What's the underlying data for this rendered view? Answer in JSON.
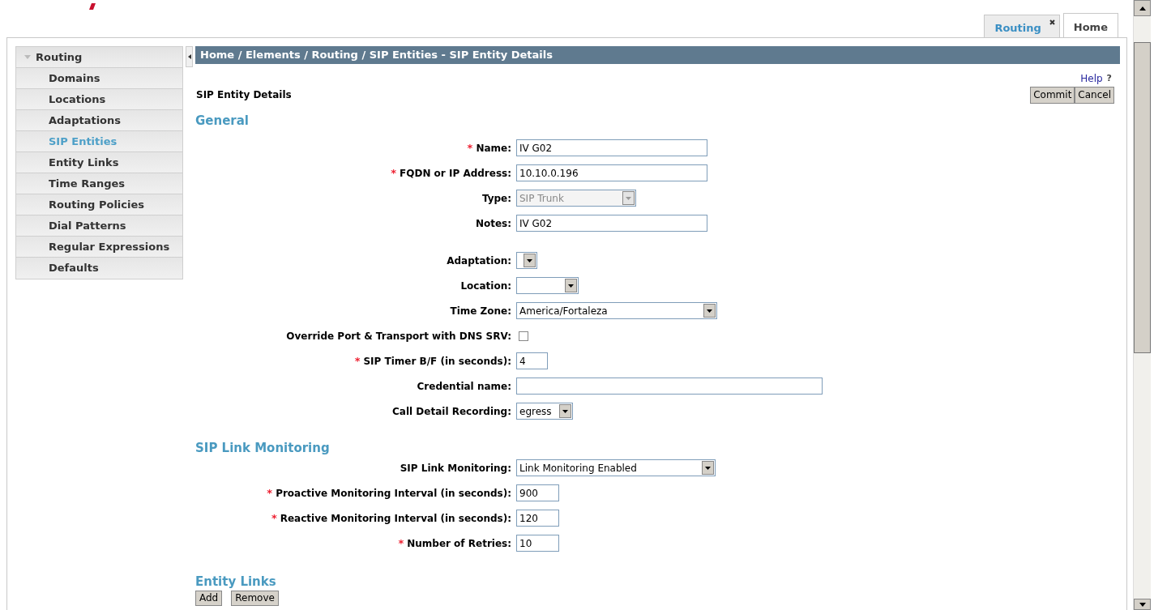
{
  "tabs": [
    {
      "label": "Routing",
      "selected": false,
      "closable": true
    },
    {
      "label": "Home",
      "selected": true,
      "closable": false
    }
  ],
  "sidebar": {
    "header": {
      "label": "Routing",
      "expanded": true
    },
    "items": [
      {
        "label": "Domains",
        "selected": false
      },
      {
        "label": "Locations",
        "selected": false
      },
      {
        "label": "Adaptations",
        "selected": false
      },
      {
        "label": "SIP Entities",
        "selected": true
      },
      {
        "label": "Entity Links",
        "selected": false
      },
      {
        "label": "Time Ranges",
        "selected": false
      },
      {
        "label": "Routing Policies",
        "selected": false
      },
      {
        "label": "Dial Patterns",
        "selected": false
      },
      {
        "label": "Regular Expressions",
        "selected": false
      },
      {
        "label": "Defaults",
        "selected": false
      }
    ]
  },
  "breadcrumb": "Home / Elements / Routing / SIP Entities - SIP Entity Details",
  "help": {
    "label": "Help",
    "mark": "?"
  },
  "page_title": "SIP Entity Details",
  "buttons": [
    "Commit",
    "Cancel"
  ],
  "sections": [
    {
      "title": "General",
      "fields": [
        {
          "label": "Name:",
          "required_mark": "*",
          "kind": "text",
          "value": "IV G02",
          "disabled": false
        },
        {
          "label": "FQDN or IP Address:",
          "required_mark": "*",
          "kind": "text",
          "value": "10.10.0.196",
          "disabled": false
        },
        {
          "label": "Type:",
          "kind": "select",
          "value": "SIP Trunk",
          "disabled": true
        },
        {
          "label": "Notes:",
          "kind": "text",
          "value": "IV G02",
          "disabled": false
        },
        {
          "label": "Adaptation:",
          "kind": "select",
          "disabled": false
        },
        {
          "label": "Location:",
          "kind": "select",
          "disabled": false
        },
        {
          "label": "Time Zone:",
          "kind": "select",
          "value": "America/Fortaleza",
          "disabled": false
        },
        {
          "label": "Override Port & Transport with DNS SRV:",
          "kind": "checkbox",
          "checked": false,
          "disabled": false
        },
        {
          "label": "SIP Timer B/F (in seconds):",
          "required_mark": "*",
          "kind": "text",
          "value": "4",
          "disabled": false
        },
        {
          "label": "Credential name:",
          "kind": "text",
          "disabled": false
        },
        {
          "label": "Call Detail Recording:",
          "kind": "select",
          "value": "egress",
          "disabled": false
        }
      ]
    },
    {
      "title": "SIP Link Monitoring",
      "fields": [
        {
          "label": "SIP Link Monitoring:",
          "kind": "select",
          "value": "Link Monitoring Enabled",
          "disabled": false
        },
        {
          "label": "Proactive Monitoring Interval (in seconds):",
          "required_mark": "*",
          "kind": "text",
          "value": "900",
          "disabled": false
        },
        {
          "label": "Reactive Monitoring Interval (in seconds):",
          "required_mark": "*",
          "kind": "text",
          "value": "120",
          "disabled": false
        },
        {
          "label": "Number of Retries:",
          "required_mark": "*",
          "kind": "text",
          "value": "10",
          "disabled": false
        }
      ]
    },
    {
      "title": "Entity Links",
      "buttons": [
        "Add",
        "Remove"
      ]
    }
  ]
}
